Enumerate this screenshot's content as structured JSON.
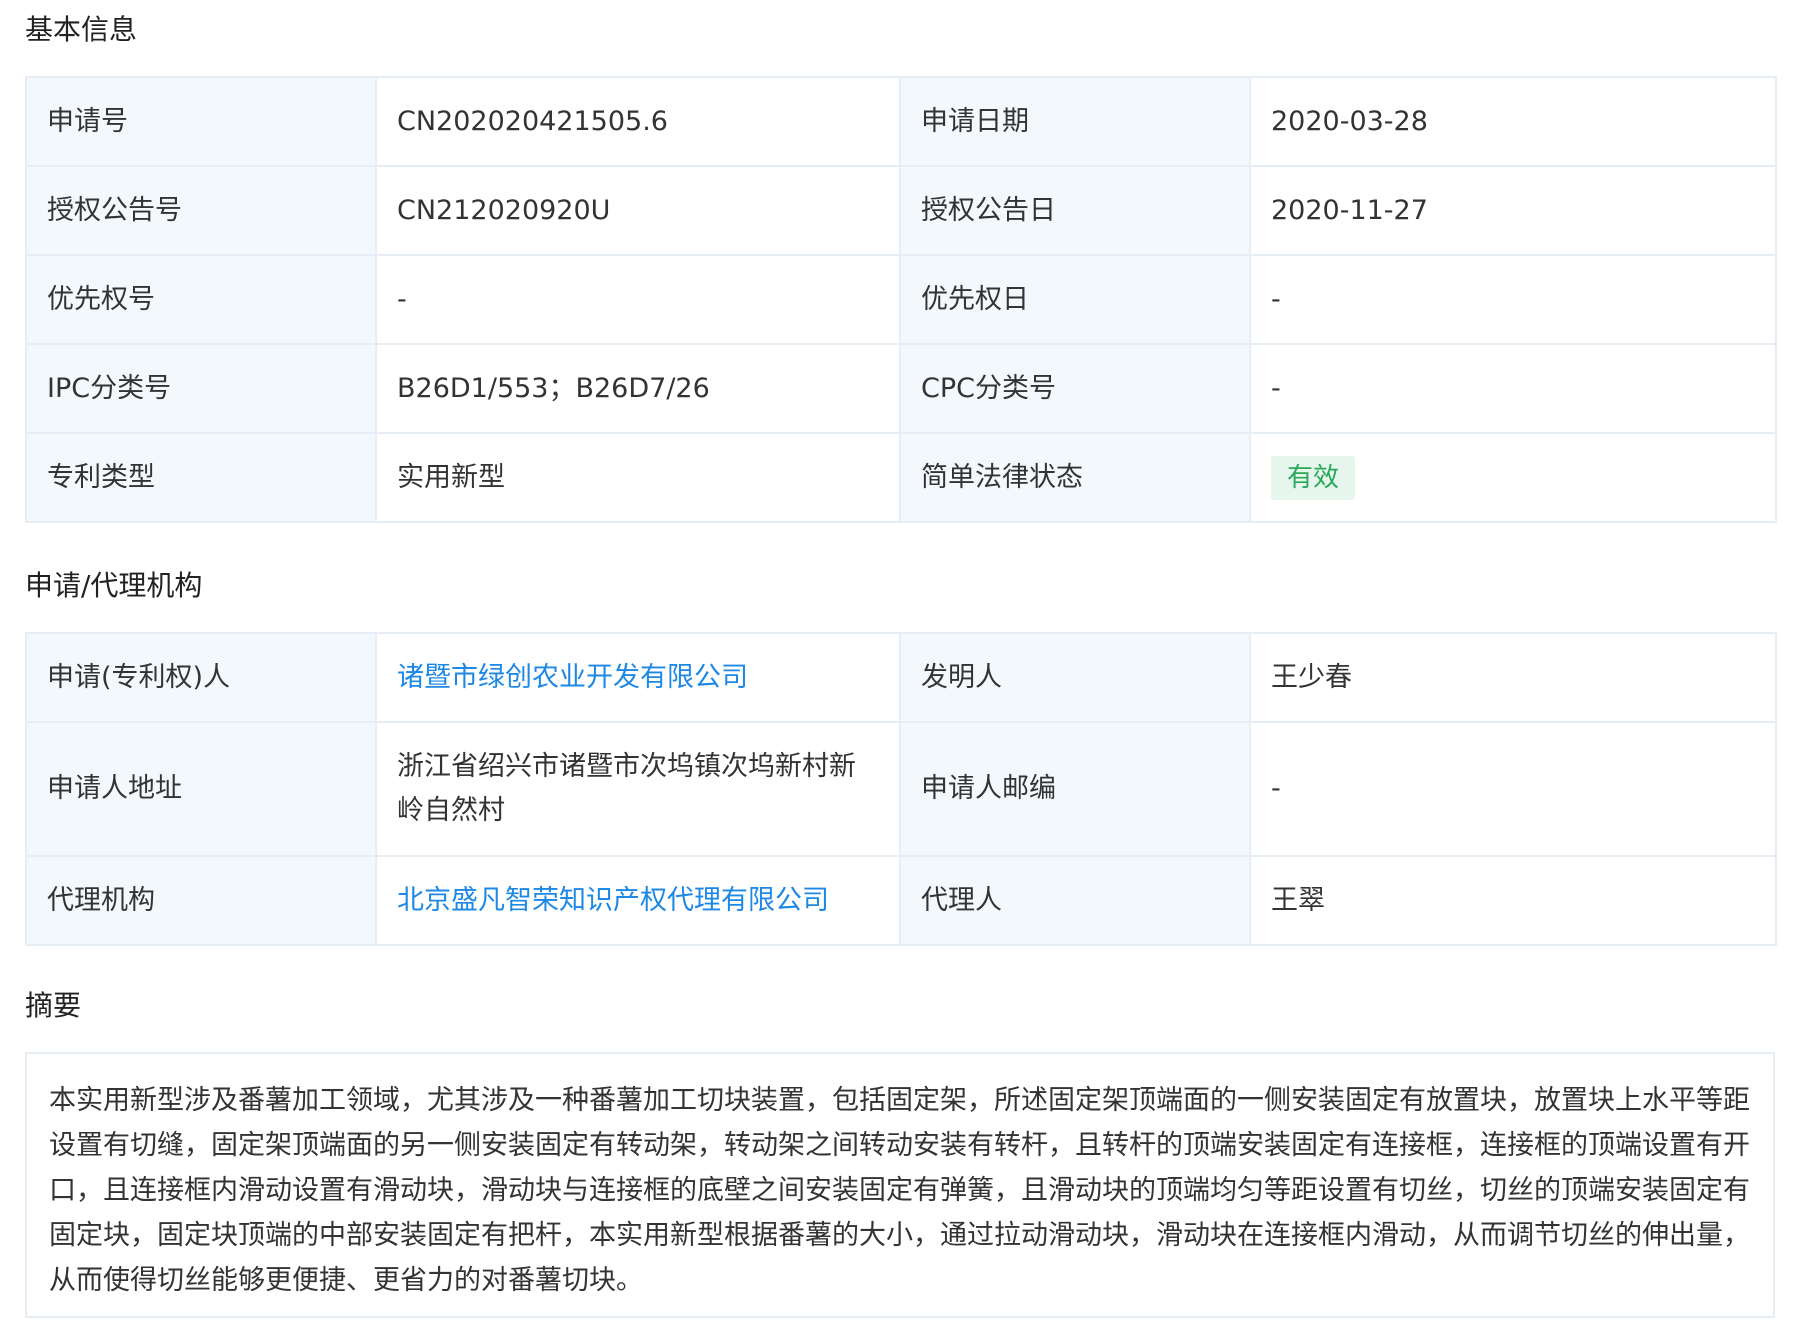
{
  "sections": {
    "basic_title": "基本信息",
    "agency_title": "申请/代理机构",
    "abstract_title": "摘要"
  },
  "basic": {
    "app_no_label": "申请号",
    "app_no": "CN202020421505.6",
    "app_date_label": "申请日期",
    "app_date": "2020-03-28",
    "grant_no_label": "授权公告号",
    "grant_no": "CN212020920U",
    "grant_date_label": "授权公告日",
    "grant_date": "2020-11-27",
    "priority_no_label": "优先权号",
    "priority_no": "-",
    "priority_date_label": "优先权日",
    "priority_date": "-",
    "ipc_label": "IPC分类号",
    "ipc": "B26D1/553；B26D7/26",
    "cpc_label": "CPC分类号",
    "cpc": "-",
    "type_label": "专利类型",
    "type": "实用新型",
    "status_label": "简单法律状态",
    "status": "有效"
  },
  "agency": {
    "applicant_label": "申请(专利权)人",
    "applicant": "诸暨市绿创农业开发有限公司",
    "inventor_label": "发明人",
    "inventor": "王少春",
    "address_label": "申请人地址",
    "address": "浙江省绍兴市诸暨市次坞镇次坞新村新岭自然村",
    "postcode_label": "申请人邮编",
    "postcode": "-",
    "agency_label": "代理机构",
    "agency": "北京盛凡智荣知识产权代理有限公司",
    "agent_label": "代理人",
    "agent": "王翠"
  },
  "abstract": {
    "text": "本实用新型涉及番薯加工领域，尤其涉及一种番薯加工切块装置，包括固定架，所述固定架顶端面的一侧安装固定有放置块，放置块上水平等距设置有切缝，固定架顶端面的另一侧安装固定有转动架，转动架之间转动安装有转杆，且转杆的顶端安装固定有连接框，连接框的顶端设置有开口，且连接框内滑动设置有滑动块，滑动块与连接框的底壁之间安装固定有弹簧，且滑动块的顶端均匀等距设置有切丝，切丝的顶端安装固定有固定块，固定块顶端的中部安装固定有把杆，本实用新型根据番薯的大小，通过拉动滑动块，滑动块在连接框内滑动，从而调节切丝的伸出量，从而使得切丝能够更便捷、更省力的对番薯切块。"
  },
  "colors": {
    "label_bg": "#f3f8fc",
    "border": "#e6edf4",
    "link": "#1e88e5",
    "badge_bg": "#e6f6ec",
    "badge_text": "#2aa85a"
  }
}
